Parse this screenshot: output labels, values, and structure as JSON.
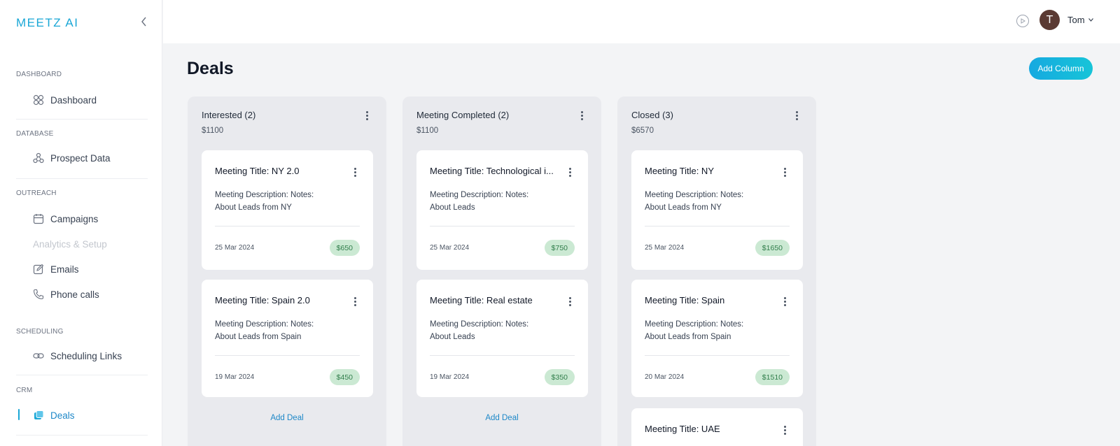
{
  "app": {
    "logo": "MEETZ AI"
  },
  "sidebar": {
    "sections": [
      {
        "label": "DASHBOARD"
      },
      {
        "label": "DATABASE"
      },
      {
        "label": "OUTREACH"
      },
      {
        "label": "SCHEDULING"
      },
      {
        "label": "CRM"
      }
    ],
    "items": [
      {
        "label": "Dashboard",
        "icon": "grid-icon"
      },
      {
        "label": "Prospect Data",
        "icon": "prospect-icon"
      },
      {
        "label": "Campaigns",
        "icon": "calendar-icon"
      },
      {
        "label": "Analytics & Setup",
        "icon": ""
      },
      {
        "label": "Emails",
        "icon": "edit-icon"
      },
      {
        "label": "Phone calls",
        "icon": "phone-icon"
      },
      {
        "label": "Scheduling Links",
        "icon": "link-icon"
      },
      {
        "label": "Deals",
        "icon": "deals-icon"
      }
    ],
    "active_item": "Deals"
  },
  "topbar": {
    "user_name": "Tom",
    "avatar_initial": "T"
  },
  "main": {
    "title": "Deals",
    "add_column_label": "Add Column",
    "columns": [
      {
        "title": "Interested (2)",
        "total": "$1100",
        "add_deal_label": "Add Deal",
        "cards": [
          {
            "title": "Meeting Title: NY 2.0",
            "desc1": "Meeting Description: Notes:",
            "desc2": "About Leads from NY",
            "date": "25 Mar 2024",
            "amount": "$650"
          },
          {
            "title": "Meeting Title: Spain 2.0",
            "desc1": "Meeting Description: Notes:",
            "desc2": "About Leads from Spain",
            "date": "19 Mar 2024",
            "amount": "$450"
          }
        ]
      },
      {
        "title": "Meeting Completed (2)",
        "total": "$1100",
        "add_deal_label": "Add Deal",
        "cards": [
          {
            "title": "Meeting Title: Technological i...",
            "desc1": "Meeting Description: Notes:",
            "desc2": "About Leads",
            "date": "25 Mar 2024",
            "amount": "$750"
          },
          {
            "title": "Meeting Title: Real estate",
            "desc1": "Meeting Description: Notes:",
            "desc2": "About Leads",
            "date": "19 Mar 2024",
            "amount": "$350"
          }
        ]
      },
      {
        "title": "Closed (3)",
        "total": "$6570",
        "cards": [
          {
            "title": "Meeting Title: NY",
            "desc1": "Meeting Description: Notes:",
            "desc2": "About Leads from NY",
            "date": "25 Mar 2024",
            "amount": "$1650"
          },
          {
            "title": "Meeting Title: Spain",
            "desc1": "Meeting Description: Notes:",
            "desc2": "About Leads from Spain",
            "date": "20 Mar 2024",
            "amount": "$1510"
          },
          {
            "title": "Meeting Title: UAE"
          }
        ]
      }
    ]
  },
  "colors": {
    "accent": "#1aa7d6",
    "amount_bg": "#cbe9d3",
    "amount_text": "#2f7d4a"
  }
}
